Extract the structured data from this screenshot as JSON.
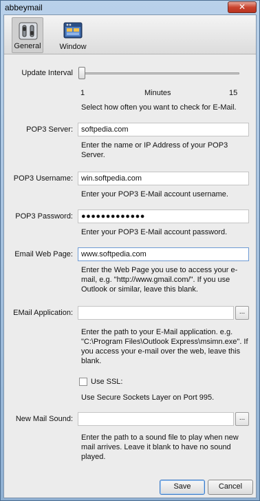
{
  "window": {
    "title": "abbeymail",
    "close_glyph": "✕"
  },
  "toolbar": {
    "tabs": [
      {
        "label": "General",
        "icon": "settings-switch-icon"
      },
      {
        "label": "Window",
        "icon": "window-icon"
      }
    ]
  },
  "update_interval": {
    "label": "Update Interval",
    "min_label": "1",
    "unit_label": "Minutes",
    "max_label": "15",
    "value": 1,
    "help": "Select how often you want to check for E-Mail."
  },
  "pop3_server": {
    "label": "POP3 Server:",
    "value": "softpedia.com",
    "help": "Enter the name or IP Address of your POP3 Server."
  },
  "pop3_username": {
    "label": "POP3 Username:",
    "value": "win.softpedia.com",
    "help": "Enter your POP3 E-Mail account username."
  },
  "pop3_password": {
    "label": "POP3 Password:",
    "value": "●●●●●●●●●●●●●",
    "help": "Enter your POP3 E-Mail account password."
  },
  "email_web_page": {
    "label": "Email Web Page:",
    "value": "www.softpedia.com",
    "help": "Enter the Web Page you use to access your e-mail, e.g. \"http://www.gmail.com/\". If you use Outlook or similar, leave this blank."
  },
  "email_application": {
    "label": "EMail Application:",
    "value": "",
    "browse_label": "...",
    "help": "Enter the path to your E-Mail application. e.g. \"C:\\Program Files\\Outlook Express\\msimn.exe\". If you access your e-mail over the web, leave this blank."
  },
  "ssl": {
    "label": "Use SSL:",
    "checked": false,
    "help": "Use Secure Sockets Layer on Port 995."
  },
  "new_mail_sound": {
    "label": "New Mail Sound:",
    "value": "",
    "browse_label": "...",
    "help": "Enter the path to a sound file to play when new mail arrives. Leave it blank to have no sound played."
  },
  "buttons": {
    "save": "Save",
    "cancel": "Cancel"
  }
}
